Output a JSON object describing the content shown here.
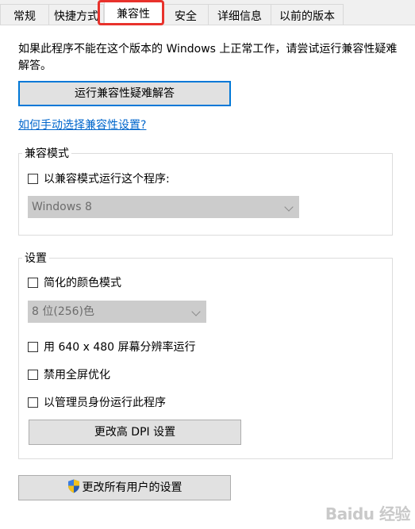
{
  "tabs": [
    {
      "label": "常规"
    },
    {
      "label": "快捷方式"
    },
    {
      "label": "兼容性"
    },
    {
      "label": "安全"
    },
    {
      "label": "详细信息"
    },
    {
      "label": "以前的版本"
    }
  ],
  "intro_text": "如果此程序不能在这个版本的 Windows 上正常工作，请尝试运行兼容性疑难解答。",
  "troubleshooter_button": "运行兼容性疑难解答",
  "manual_link": "如何手动选择兼容性设置?",
  "compat_mode": {
    "title": "兼容模式",
    "checkbox_label": "以兼容模式运行这个程序:",
    "checked": false,
    "os_select_value": "Windows 8"
  },
  "settings": {
    "title": "设置",
    "reduced_color": {
      "label": "简化的颜色模式",
      "checked": false
    },
    "color_select_value": "8 位(256)色",
    "res_640": {
      "label": "用 640 x 480 屏幕分辨率运行",
      "checked": false
    },
    "disable_fullscreen": {
      "label": "禁用全屏优化",
      "checked": false
    },
    "run_admin": {
      "label": "以管理员身份运行此程序",
      "checked": false
    },
    "dpi_button": "更改高 DPI 设置"
  },
  "all_users_button": "更改所有用户的设置",
  "colors": {
    "highlight": "#e8322c",
    "link": "#0066cc",
    "focus": "#0078d7"
  },
  "watermark": "Baidu 经验"
}
